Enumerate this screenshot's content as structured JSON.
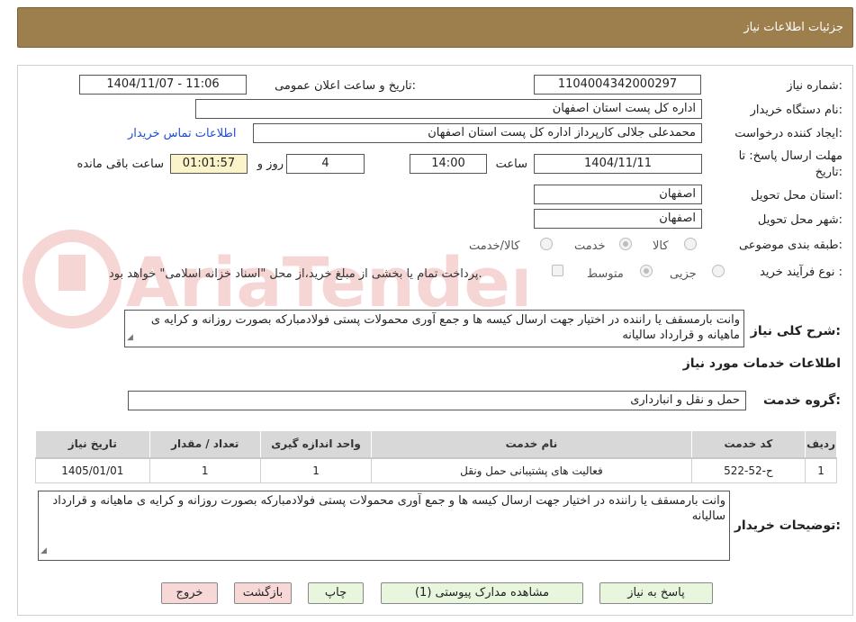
{
  "header": {
    "title": "جزئیات اطلاعات نیاز"
  },
  "form": {
    "need_number_label": "شماره نیاز:",
    "need_number": "1104004342000297",
    "announce_label": "تاریخ و ساعت اعلان عمومی:",
    "announce_value": "1404/11/07 - 11:06",
    "buyer_org_label": "نام دستگاه خریدار:",
    "buyer_org": "اداره کل پست استان اصفهان",
    "requester_label": "ایجاد کننده درخواست:",
    "requester": "محمدعلی جلالی کارپرداز اداره کل پست استان اصفهان",
    "contact_link": "اطلاعات تماس خریدار",
    "deadline_label_1": "مهلت ارسال پاسخ: تا",
    "deadline_label_2": "تاریخ:",
    "deadline_date": "1404/11/11",
    "time_label": "ساعت",
    "deadline_time": "14:00",
    "days_value": "4",
    "days_label": "روز و",
    "remaining_time": "01:01:57",
    "remaining_label": "ساعت باقی مانده",
    "province_label": "استان محل تحویل:",
    "province": "اصفهان",
    "city_label": "شهر محل تحویل:",
    "city": "اصفهان",
    "category_label": "طبقه بندی موضوعی:",
    "category_options": [
      "کالا",
      "خدمت",
      "کالا/خدمت"
    ],
    "process_label": "نوع فرآیند خرید :",
    "process_options": [
      "جزیی",
      "متوسط"
    ],
    "payment_note": "پرداخت تمام یا بخشی از مبلغ خرید،از محل \"اسناد خزانه اسلامی\" خواهد بود."
  },
  "description": {
    "label": "شرح کلی نیاز:",
    "text": "وانت بارمسقف یا راننده در اختیار جهت ارسال کیسه ها و جمع آوری محمولات پستی  فولادمبارکه بصورت روزانه و کرایه ی ماهیانه و قرارداد سالیانه"
  },
  "services": {
    "section_title": "اطلاعات خدمات مورد نیاز",
    "group_label": "گروه خدمت:",
    "group_value": "حمل و نقل و انبارداری",
    "columns": [
      "ردیف",
      "کد خدمت",
      "نام خدمت",
      "واحد اندازه گیری",
      "تعداد / مقدار",
      "تاریخ نیاز"
    ],
    "rows": [
      [
        "1",
        "ح-52-522",
        "فعالیت های پشتیبانی حمل ونقل",
        "1",
        "1",
        "1405/01/01"
      ]
    ]
  },
  "buyer_notes": {
    "label": "توضیحات خریدار:",
    "text": "وانت بارمسقف یا راننده در اختیار جهت ارسال کیسه ها و جمع آوری محمولات پستی  فولادمبارکه بصورت روزانه و کرایه ی ماهیانه و قرارداد سالیانه"
  },
  "buttons": {
    "reply": "پاسخ به نیاز",
    "attachments": "مشاهده مدارک پیوستی (1)",
    "print": "چاپ",
    "back": "بازگشت",
    "exit": "خروج"
  },
  "watermark_text": "AriaTender.neT",
  "colors": {
    "header_bg": "#9c7f4d",
    "button_green": "#e7f6dc",
    "button_pink": "#f8d7d7",
    "link": "#1f4ed3",
    "timer_bg": "#fbf3c9"
  }
}
